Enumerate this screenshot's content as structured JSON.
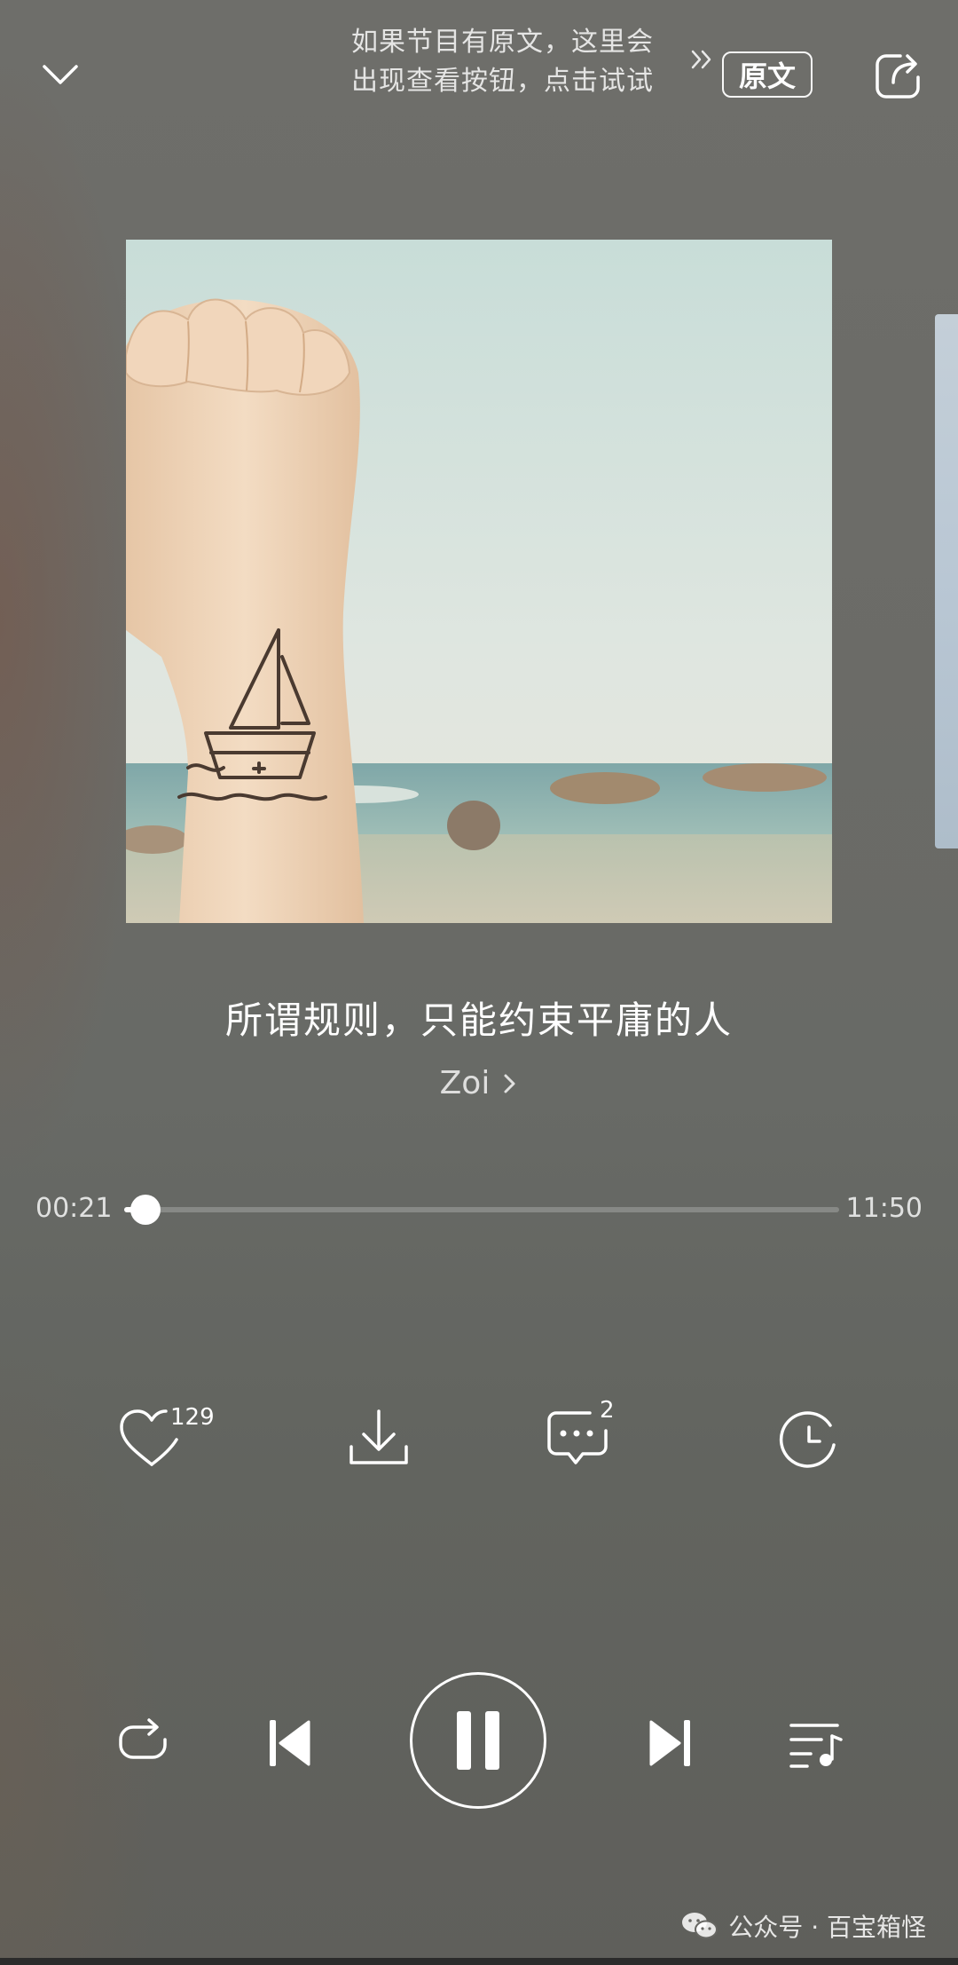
{
  "header": {
    "hint_line1": "如果节目有原文，这里会",
    "hint_line2": "出现查看按钮，点击试试",
    "original_label": "原文"
  },
  "track": {
    "title": "所谓规则，只能约束平庸的人",
    "artist": "Zoi"
  },
  "progress": {
    "elapsed": "00:21",
    "total": "11:50",
    "fraction": 0.03
  },
  "actions": {
    "like_count": "129",
    "comment_count": "2"
  },
  "icons": {
    "collapse": "chevron-down-icon",
    "share": "share-icon",
    "like": "heart-icon",
    "download": "download-icon",
    "comment": "comment-icon",
    "timer": "timer-icon",
    "repeat": "repeat-icon",
    "previous": "previous-icon",
    "pause": "pause-icon",
    "next": "next-icon",
    "playlist": "playlist-icon"
  },
  "watermark": {
    "text": "公众号 · 百宝箱怪"
  },
  "colors": {
    "background": "#6a6b67",
    "accent": "#ffffff"
  }
}
